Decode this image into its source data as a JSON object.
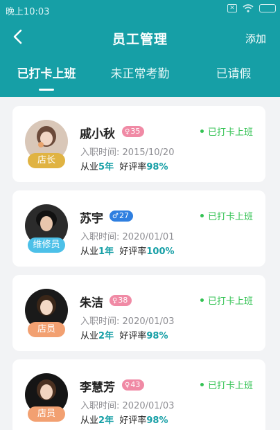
{
  "status_bar": {
    "time": "晚上10:03"
  },
  "header": {
    "title": "员工管理",
    "add_label": "添加"
  },
  "tabs": [
    {
      "label": "已打卡上班",
      "active": true
    },
    {
      "label": "未正常考勤",
      "active": false
    },
    {
      "label": "已请假",
      "active": false
    }
  ],
  "labels": {
    "join_prefix": "入职时间:",
    "exp_prefix": "从业",
    "exp_unit": "年",
    "rating_prefix": "好评率"
  },
  "employees": [
    {
      "name": "戚小秋",
      "gender": "female",
      "age": "35",
      "role": "店长",
      "join_date": "2015/10/20",
      "years": "5",
      "rating": "98%",
      "status": "已打卡上班"
    },
    {
      "name": "苏宇",
      "gender": "male",
      "age": "27",
      "role": "维修员",
      "join_date": "2020/01/01",
      "years": "1",
      "rating": "100%",
      "status": "已打卡上班"
    },
    {
      "name": "朱洁",
      "gender": "female",
      "age": "38",
      "role": "店员",
      "join_date": "2020/01/03",
      "years": "2",
      "rating": "98%",
      "status": "已打卡上班"
    },
    {
      "name": "李慧芳",
      "gender": "female",
      "age": "43",
      "role": "店员",
      "join_date": "2020/01/03",
      "years": "2",
      "rating": "98%",
      "status": "已打卡上班"
    }
  ],
  "colors": {
    "primary": "#169fa6",
    "status_green": "#33c253",
    "tag_female": "#f08aa5",
    "tag_male": "#2f7fe0",
    "role_manager": "#e0b342",
    "role_repair": "#4cc0e8",
    "role_staff": "#f2a071"
  }
}
